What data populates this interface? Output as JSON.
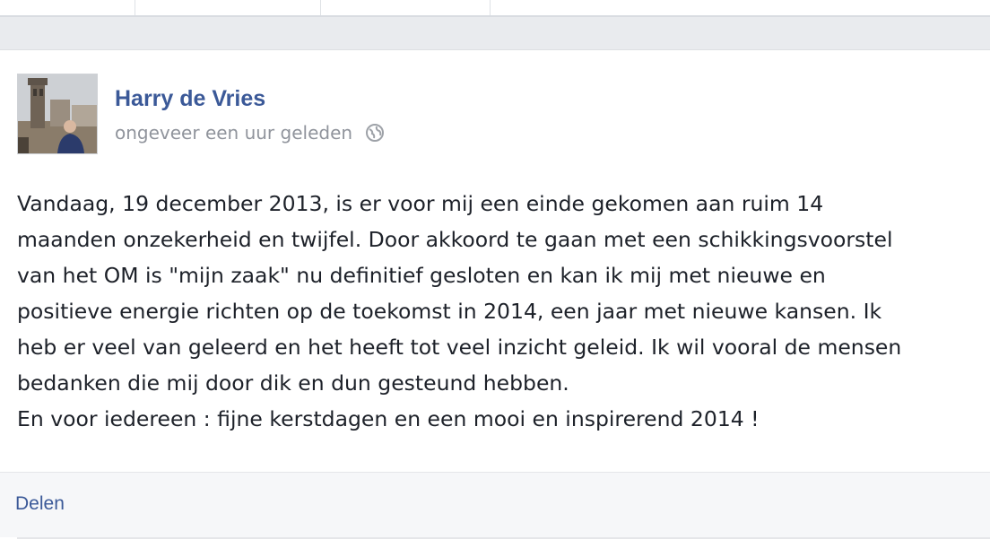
{
  "post": {
    "author": "Harry de Vries",
    "timestamp": "ongeveer een uur geleden",
    "privacy_icon": "globe-icon",
    "body_lines": [
      "Vandaag, 19 december 2013, is er voor mij een einde gekomen aan ruim 14",
      "maanden onzekerheid en twijfel. Door akkoord te gaan met een schikkingsvoorstel",
      "van het OM is \"mijn zaak\" nu definitief gesloten en kan ik mij met nieuwe en",
      "positieve energie richten op de toekomst in 2014, een jaar met nieuwe kansen. Ik",
      "heb er veel van geleerd en het heeft tot veel inzicht geleid. Ik wil vooral de mensen",
      "bedanken die mij door dik en dun gesteund hebben.",
      "En voor iedereen : fijne kerstdagen en een mooi en inspirerend 2014 !"
    ]
  },
  "actions": {
    "share_label": "Delen"
  },
  "colors": {
    "link": "#3b5998",
    "muted": "#90949c",
    "text": "#1d2129",
    "background": "#e9ebee"
  }
}
